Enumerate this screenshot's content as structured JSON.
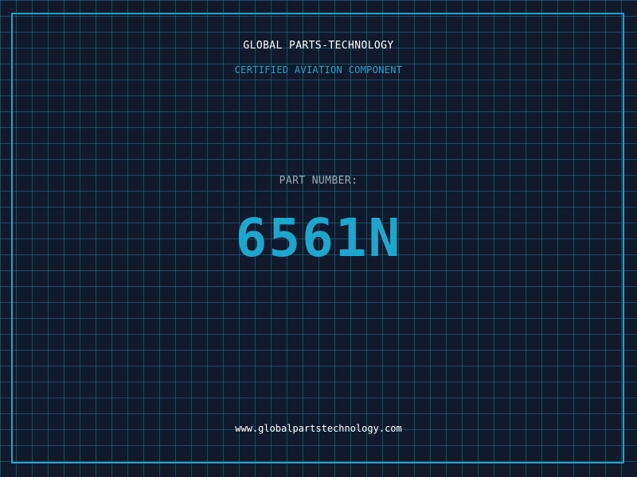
{
  "header": {
    "company": "GLOBAL PARTS-TECHNOLOGY",
    "tagline": "CERTIFIED AVIATION COMPONENT"
  },
  "part": {
    "label": "PART NUMBER:",
    "number": "6561N"
  },
  "footer": {
    "website": "www.globalpartstechnology.com"
  },
  "colors": {
    "background": "#111a2d",
    "grid": "#286e8c",
    "accent": "#1ba3c8",
    "text_primary": "#ffffff",
    "text_muted": "#9aa7b8"
  }
}
